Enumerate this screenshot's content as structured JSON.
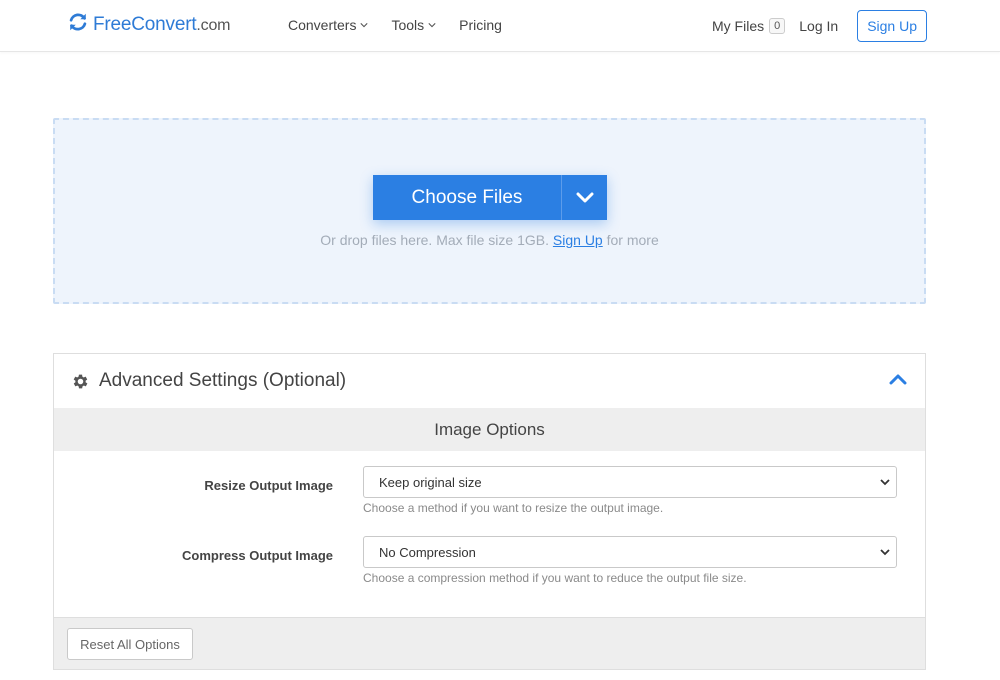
{
  "header": {
    "logo_text": "FreeConvert",
    "logo_domain": ".com",
    "nav": [
      {
        "label": "Converters",
        "has_dropdown": true
      },
      {
        "label": "Tools",
        "has_dropdown": true
      },
      {
        "label": "Pricing",
        "has_dropdown": false
      }
    ],
    "my_files_label": "My Files",
    "my_files_count": "0",
    "login_label": "Log In",
    "signup_label": "Sign Up"
  },
  "upload": {
    "choose_files_label": "Choose Files",
    "hint_prefix": "Or drop files here. Max file size 1GB.",
    "hint_link": "Sign Up",
    "hint_suffix": "for more"
  },
  "advanced": {
    "title": "Advanced Settings (Optional)",
    "section_title": "Image Options",
    "options": [
      {
        "label": "Resize Output Image",
        "selected": "Keep original size",
        "help": "Choose a method if you want to resize the output image."
      },
      {
        "label": "Compress Output Image",
        "selected": "No Compression",
        "help": "Choose a compression method if you want to reduce the output file size."
      }
    ],
    "reset_label": "Reset All Options"
  },
  "colors": {
    "brand": "#2b7fe3",
    "dropzone_bg": "#eef4fc",
    "panel_header_bg": "#eeeeee"
  },
  "icons": [
    "refresh-logo-icon",
    "chevron-down-icon",
    "gear-icon",
    "chevron-up-icon",
    "select-caret-icon"
  ]
}
